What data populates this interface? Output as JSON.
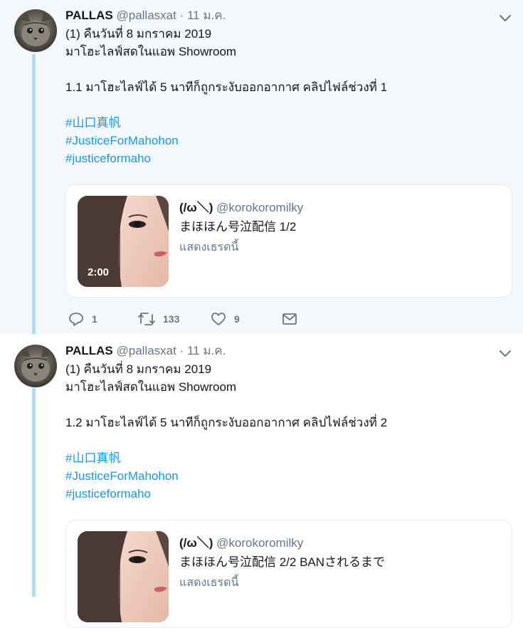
{
  "tweets": [
    {
      "name": "PALLAS",
      "handle": "@pallasxat",
      "separator": "·",
      "date": "11 ม.ค.",
      "lines": [
        "(1) คืนวันที่ 8 มกราคม 2019",
        "มาโฮะไลฟ์สดในแอพ Showroom",
        "",
        "1.1 มาโฮะไลฟ์ได้ 5 นาทีก็ถูกระงับออกอากาศ คลิปไฟล์ช่วงที่ 1",
        ""
      ],
      "hashtags": [
        "#山口真帆",
        "#JusticeForMahohon",
        "#justiceformaho"
      ],
      "quote": {
        "name": "(/ω＼)",
        "handle": "@korokoromilky",
        "text": "まほほん号泣配信 1/2",
        "show_thread": "แสดงเธรดนี้",
        "video_duration": "2:00"
      },
      "actions": {
        "replies": "1",
        "retweets": "133",
        "likes": "9"
      }
    },
    {
      "name": "PALLAS",
      "handle": "@pallasxat",
      "separator": "·",
      "date": "11 ม.ค.",
      "lines": [
        "(1) คืนวันที่ 8 มกราคม 2019",
        "มาโฮะไลฟ์สดในแอพ Showroom",
        "",
        "1.2 มาโฮะไลฟ์ได้ 5 นาทีก็ถูกระงับออกอากาศ คลิปไฟล์ช่วงที่ 2",
        ""
      ],
      "hashtags": [
        "#山口真帆",
        "#JusticeForMahohon",
        "#justiceformaho"
      ],
      "quote": {
        "name": "(/ω＼)",
        "handle": "@korokoromilky",
        "text": "まほほん号泣配信 2/2 BANされるまで",
        "show_thread": "แสดงเธรดนี้"
      }
    }
  ],
  "colors": {
    "link": "#1b95e0",
    "thread_line": "#b3daf7",
    "muted": "#657786",
    "highlight_bg": "#f5f8fa"
  },
  "icons": [
    "avatar-cat-photo",
    "chevron-down-icon",
    "reply-icon",
    "retweet-icon",
    "like-icon",
    "dm-icon"
  ]
}
